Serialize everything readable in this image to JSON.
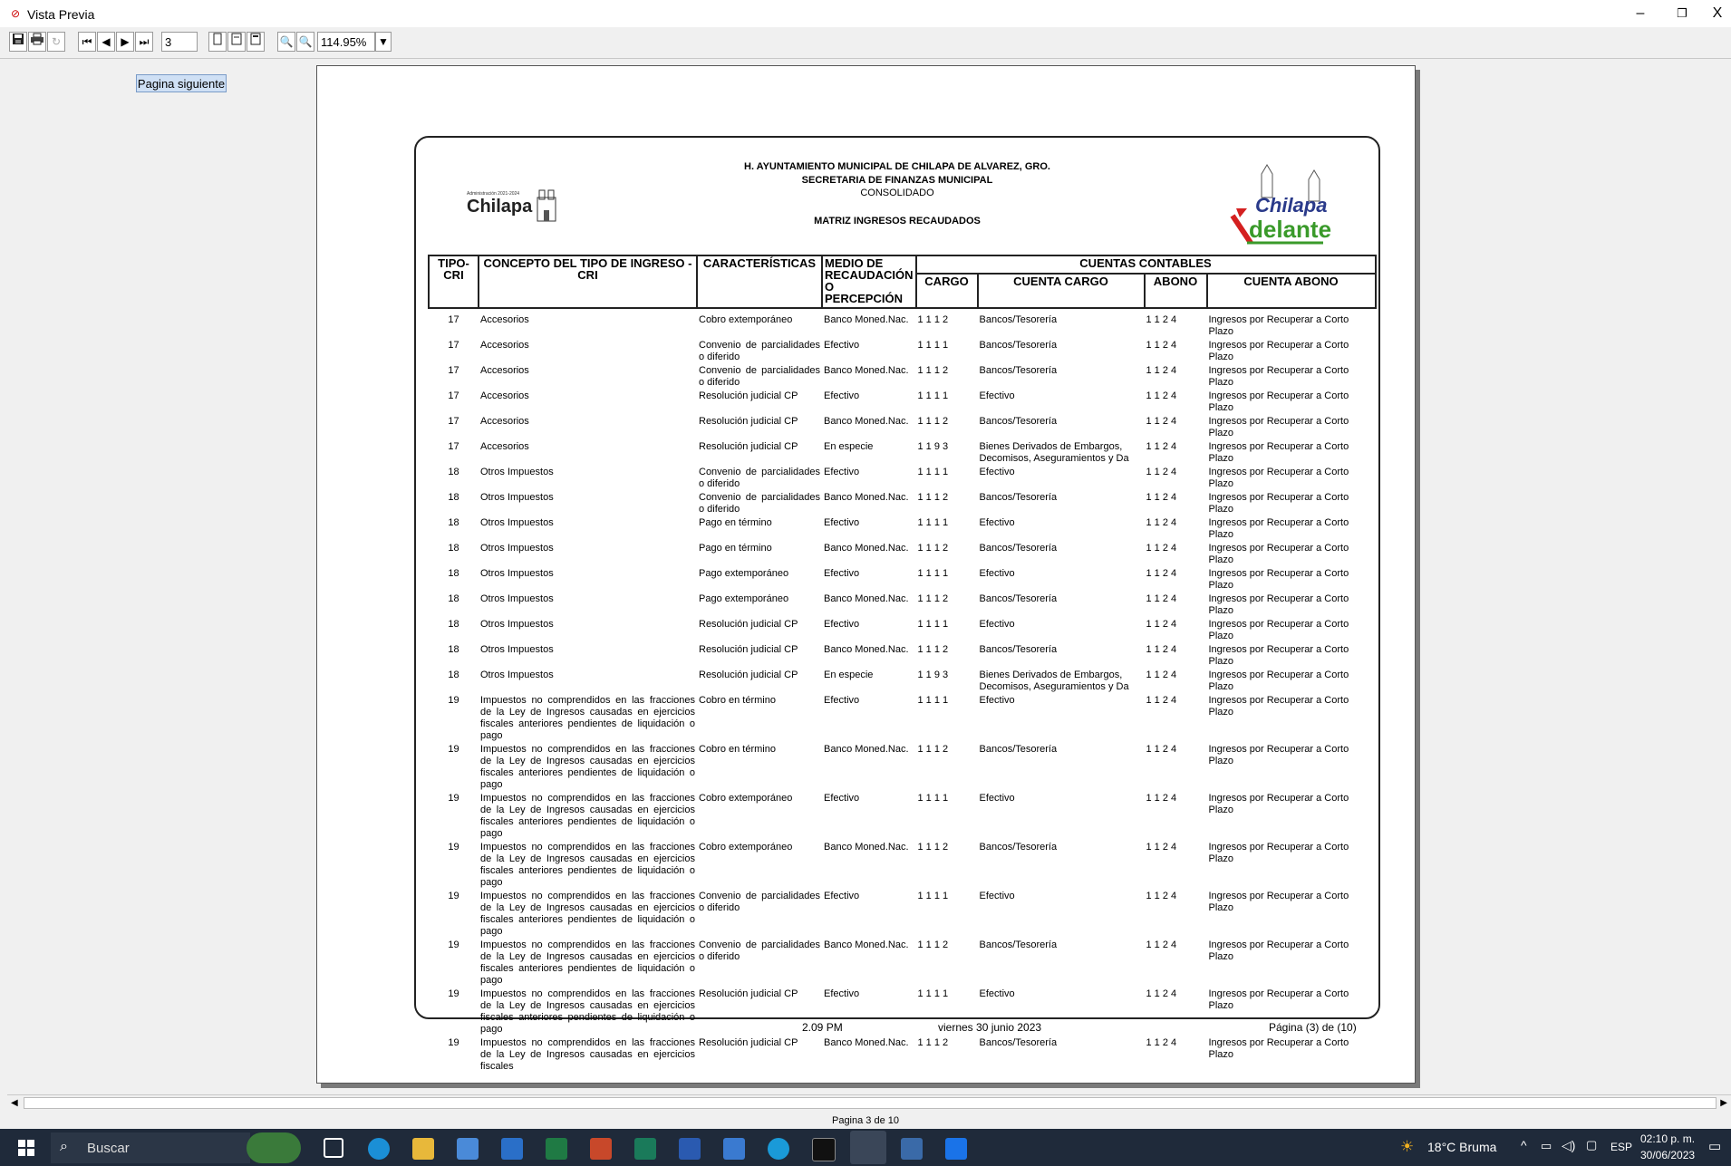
{
  "window": {
    "title": "Vista Previa",
    "minimize": "–",
    "restore": "❐",
    "close": "X"
  },
  "toolbar": {
    "page_input": "3",
    "zoom_value": "114.95%"
  },
  "sidebar": {
    "next_page_button": "Pagina siguiente"
  },
  "report": {
    "header_lines": [
      "H. AYUNTAMIENTO MUNICIPAL DE CHILAPA DE ALVAREZ, GRO.",
      "SECRETARIA DE FINANZAS MUNICIPAL",
      "CONSOLIDADO",
      "MATRIZ INGRESOS RECAUDADOS"
    ],
    "logo_left_small": "Administración 2021-2024",
    "logo_left_name": "Chilapa",
    "logo_right_top": "Chilapa",
    "logo_right_bottom": "delante",
    "columns": {
      "tipo": "TIPO-CRI",
      "concepto": "CONCEPTO DEL TIPO DE INGRESO - CRI",
      "caracteristicas": "CARACTERÍSTICAS",
      "medio": "MEDIO DE RECAUDACIÓN O PERCEPCIÓN",
      "cuentas": "CUENTAS CONTABLES",
      "cargo": "CARGO",
      "cuenta_cargo": "CUENTA CARGO",
      "abono": "ABONO",
      "cuenta_abono": "CUENTA ABONO"
    },
    "rows": [
      [
        "17",
        "Accesorios",
        "Cobro extemporáneo",
        "Banco Moned.Nac.",
        "1 1 1 2",
        "Bancos/Tesorería",
        "1 1 2 4",
        "Ingresos por Recuperar a Corto Plazo"
      ],
      [
        "17",
        "Accesorios",
        "Convenio de parcialidades o diferido",
        "Efectivo",
        "1 1 1 1",
        "Bancos/Tesorería",
        "1 1 2 4",
        "Ingresos por Recuperar a Corto Plazo"
      ],
      [
        "17",
        "Accesorios",
        "Convenio de parcialidades o diferido",
        "Banco Moned.Nac.",
        "1 1 1 2",
        "Bancos/Tesorería",
        "1 1 2 4",
        "Ingresos por Recuperar a Corto Plazo"
      ],
      [
        "17",
        "Accesorios",
        "Resolución judicial CP",
        "Efectivo",
        "1 1 1 1",
        "Efectivo",
        "1 1 2 4",
        "Ingresos por Recuperar a Corto Plazo"
      ],
      [
        "17",
        "Accesorios",
        "Resolución judicial CP",
        "Banco Moned.Nac.",
        "1 1 1 2",
        "Bancos/Tesorería",
        "1 1 2 4",
        "Ingresos por Recuperar a Corto Plazo"
      ],
      [
        "17",
        "Accesorios",
        "Resolución judicial CP",
        "En especie",
        "1 1 9 3",
        "Bienes Derivados de Embargos, Decomisos, Aseguramientos y Da",
        "1 1 2 4",
        "Ingresos por Recuperar a Corto Plazo"
      ],
      [
        "18",
        "Otros Impuestos",
        "Convenio de parcialidades o diferido",
        "Efectivo",
        "1 1 1 1",
        "Efectivo",
        "1 1 2 4",
        "Ingresos por Recuperar a Corto Plazo"
      ],
      [
        "18",
        "Otros Impuestos",
        "Convenio de parcialidades o diferido",
        "Banco Moned.Nac.",
        "1 1 1 2",
        "Bancos/Tesorería",
        "1 1 2 4",
        "Ingresos por Recuperar a Corto Plazo"
      ],
      [
        "18",
        "Otros Impuestos",
        "Pago en término",
        "Efectivo",
        "1 1 1 1",
        "Efectivo",
        "1 1 2 4",
        "Ingresos por Recuperar a Corto Plazo"
      ],
      [
        "18",
        "Otros Impuestos",
        "Pago en término",
        "Banco Moned.Nac.",
        "1 1 1 2",
        "Bancos/Tesorería",
        "1 1 2 4",
        "Ingresos por Recuperar a Corto Plazo"
      ],
      [
        "18",
        "Otros Impuestos",
        "Pago extemporáneo",
        "Efectivo",
        "1 1 1 1",
        "Efectivo",
        "1 1 2 4",
        "Ingresos por Recuperar a Corto Plazo"
      ],
      [
        "18",
        "Otros Impuestos",
        "Pago extemporáneo",
        "Banco Moned.Nac.",
        "1 1 1 2",
        "Bancos/Tesorería",
        "1 1 2 4",
        "Ingresos por Recuperar a Corto Plazo"
      ],
      [
        "18",
        "Otros Impuestos",
        "Resolución judicial CP",
        "Efectivo",
        "1 1 1 1",
        "Efectivo",
        "1 1 2 4",
        "Ingresos por Recuperar a Corto Plazo"
      ],
      [
        "18",
        "Otros Impuestos",
        "Resolución judicial CP",
        "Banco Moned.Nac.",
        "1 1 1 2",
        "Bancos/Tesorería",
        "1 1 2 4",
        "Ingresos por Recuperar a Corto Plazo"
      ],
      [
        "18",
        "Otros Impuestos",
        "Resolución judicial CP",
        "En especie",
        "1 1 9 3",
        "Bienes Derivados de Embargos, Decomisos, Aseguramientos y Da",
        "1 1 2 4",
        "Ingresos por Recuperar a Corto Plazo"
      ],
      [
        "19",
        "Impuestos no comprendidos en las fracciones de la Ley de Ingresos causadas en ejercicios fiscales anteriores pendientes de liquidación o pago",
        "Cobro en término",
        "Efectivo",
        "1 1 1 1",
        "Efectivo",
        "1 1 2 4",
        "Ingresos por Recuperar a Corto Plazo"
      ],
      [
        "19",
        "Impuestos no comprendidos en las fracciones de la Ley de Ingresos causadas en ejercicios fiscales anteriores pendientes de liquidación o pago",
        "Cobro en término",
        "Banco Moned.Nac.",
        "1 1 1 2",
        "Bancos/Tesorería",
        "1 1 2 4",
        "Ingresos por Recuperar a Corto Plazo"
      ],
      [
        "19",
        "Impuestos no comprendidos en las fracciones de la Ley de Ingresos causadas en ejercicios fiscales anteriores pendientes de liquidación o pago",
        "Cobro extemporáneo",
        "Efectivo",
        "1 1 1 1",
        "Efectivo",
        "1 1 2 4",
        "Ingresos por Recuperar a Corto Plazo"
      ],
      [
        "19",
        "Impuestos no comprendidos en las fracciones de la Ley de Ingresos causadas en ejercicios fiscales anteriores pendientes de liquidación o pago",
        "Cobro extemporáneo",
        "Banco Moned.Nac.",
        "1 1 1 2",
        "Bancos/Tesorería",
        "1 1 2 4",
        "Ingresos por Recuperar a Corto Plazo"
      ],
      [
        "19",
        "Impuestos no comprendidos en las fracciones de la Ley de Ingresos causadas en ejercicios fiscales anteriores pendientes de liquidación o pago",
        "Convenio de parcialidades o diferido",
        "Efectivo",
        "1 1 1 1",
        "Efectivo",
        "1 1 2 4",
        "Ingresos por Recuperar a Corto Plazo"
      ],
      [
        "19",
        "Impuestos no comprendidos en las fracciones de la Ley de Ingresos causadas en ejercicios fiscales anteriores pendientes de liquidación o pago",
        "Convenio de parcialidades o diferido",
        "Banco Moned.Nac.",
        "1 1 1 2",
        "Bancos/Tesorería",
        "1 1 2 4",
        "Ingresos por Recuperar a Corto Plazo"
      ],
      [
        "19",
        "Impuestos no comprendidos en las fracciones de la Ley de Ingresos causadas en ejercicios fiscales anteriores pendientes de liquidación o pago",
        "Resolución judicial CP",
        "Efectivo",
        "1 1 1 1",
        "Efectivo",
        "1 1 2 4",
        "Ingresos por Recuperar a Corto Plazo"
      ],
      [
        "19",
        "Impuestos no comprendidos en las fracciones de la Ley de Ingresos causadas en ejercicios fiscales",
        "Resolución judicial CP",
        "Banco Moned.Nac.",
        "1 1 1 2",
        "Bancos/Tesorería",
        "1 1 2 4",
        "Ingresos por Recuperar a Corto Plazo"
      ]
    ],
    "footer": {
      "time": "2.09 PM",
      "date": "viernes 30 junio 2023",
      "page": "Página (3) de (10)"
    }
  },
  "status": {
    "page_indicator": "Pagina 3 de 10"
  },
  "taskbar": {
    "search_placeholder": "Buscar",
    "weather": "18°C  Bruma",
    "lang": "ESP",
    "time": "02:10 p. m.",
    "date": "30/06/2023"
  }
}
